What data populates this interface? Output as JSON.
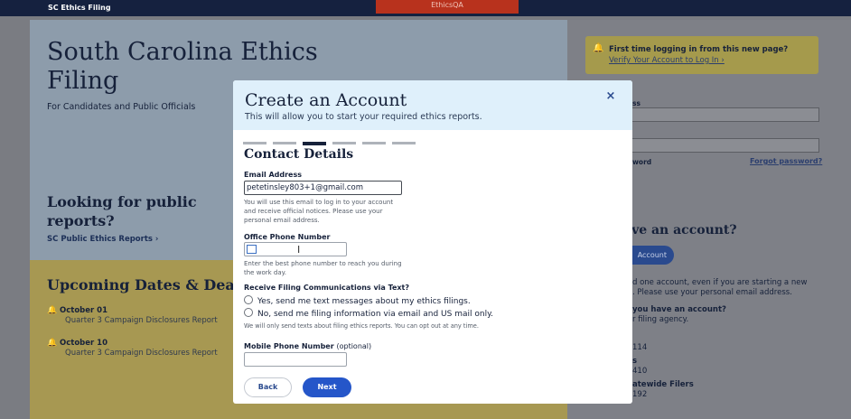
{
  "topbar": {
    "brand": "SC Ethics Filing",
    "environment": "EthicsQA"
  },
  "hero": {
    "title": "South Carolina Ethics Filing",
    "subtitle": "For Candidates and Public Officials",
    "looking_title": "Looking for public reports?",
    "public_link": "SC Public Ethics Reports ›"
  },
  "upcoming": {
    "title": "Upcoming Dates & Deadlines",
    "events": [
      {
        "date": "October 01",
        "desc": "Quarter 3 Campaign Disclosures Report"
      },
      {
        "date": "October 10",
        "desc": "Quarter 3 Campaign Disclosures Report"
      }
    ]
  },
  "right": {
    "notice_line1": "First time logging in from this new page?",
    "notice_line2": "Verify Your Account to Log In ›",
    "login_heading": "n",
    "email_label": "ss",
    "password_label": "word",
    "forgot": "Forgot password?",
    "have_account": "ave an account?",
    "create_btn": "Account",
    "note_line1": "d one account, even if you are starting a new",
    "note_line2": ". Please use your personal email address.",
    "q_heading": "you have an account?",
    "q_sub": "r filing agency.",
    "phone1": "114",
    "s_label": "s",
    "phone2": "410",
    "statewide": "atewide Filers",
    "phone3": "192"
  },
  "modal": {
    "title": "Create an Account",
    "subtitle": "This will allow you to start your required ethics reports.",
    "close_symbol": "×",
    "current_step": 3,
    "total_steps": 6,
    "section": "Contact Details",
    "email": {
      "label": "Email Address",
      "value": "petetinsley803+1@gmail.com",
      "hint": "You will use this email to log in to your account and receive official notices. Please use your personal email address."
    },
    "office_phone": {
      "label": "Office Phone Number",
      "value": "",
      "hint": "Enter the best phone number to reach you during the work day."
    },
    "texts": {
      "label": "Receive Filing Communications via Text?",
      "option_yes": "Yes, send me text messages about my ethics filings.",
      "option_no": "No, send me filing information via email and US mail only.",
      "note": "We will only send texts about filing ethics reports. You can opt out at any time."
    },
    "mobile_phone": {
      "label": "Mobile Phone Number",
      "optional": "(optional)",
      "value": ""
    },
    "back_label": "Back",
    "next_label": "Next"
  },
  "colors": {
    "primary": "#2556c9",
    "header_bg": "#dff0fb",
    "navy": "#15213f"
  }
}
